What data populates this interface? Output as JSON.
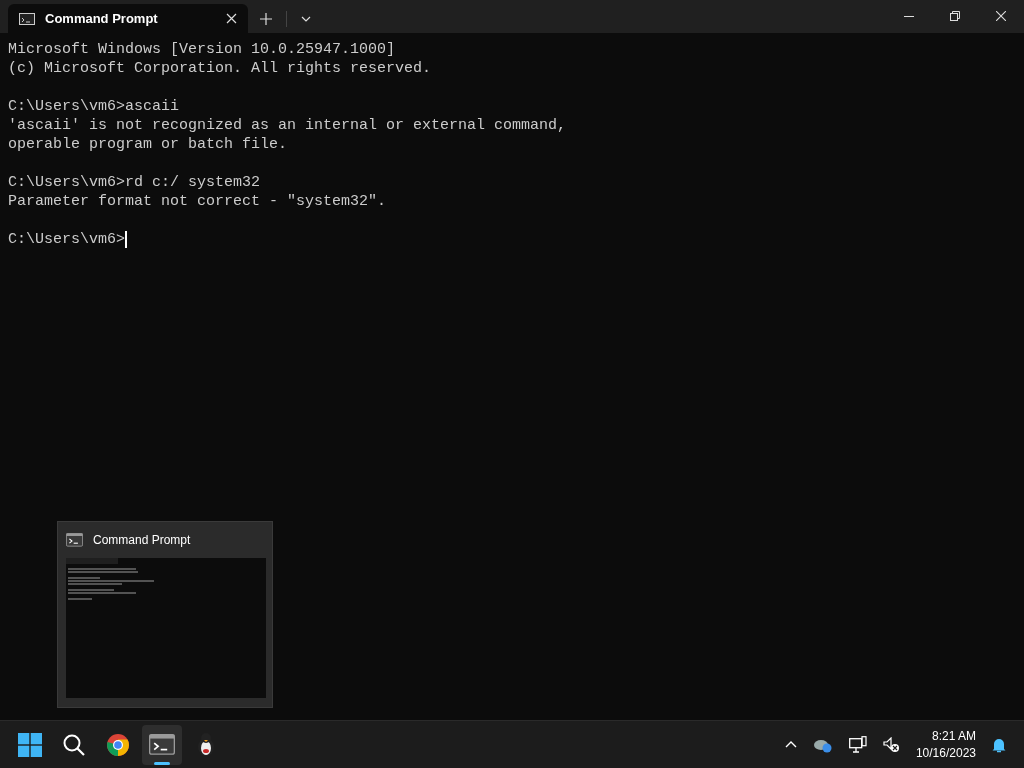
{
  "window": {
    "tabs": [
      {
        "title": "Command Prompt",
        "selected": true
      }
    ]
  },
  "console": {
    "blocks": [
      [
        "Microsoft Windows [Version 10.0.25947.1000]",
        "(c) Microsoft Corporation. All rights reserved."
      ],
      [
        "C:\\Users\\vm6>ascaii",
        "'ascaii' is not recognized as an internal or external command,",
        "operable program or batch file."
      ],
      [
        "C:\\Users\\vm6>rd c:/ system32",
        "Parameter format not correct - \"system32\"."
      ],
      [
        "C:\\Users\\vm6>"
      ]
    ],
    "cursor": true
  },
  "preview": {
    "title": "Command Prompt"
  },
  "taskbar": {
    "apps": [
      {
        "kind": "start",
        "selected": false
      },
      {
        "kind": "search",
        "selected": false
      },
      {
        "kind": "browser",
        "selected": false
      },
      {
        "kind": "terminal",
        "selected": true
      },
      {
        "kind": "penguin",
        "selected": false
      }
    ],
    "clock": {
      "time": "8:21 AM",
      "date": "10/16/2023"
    }
  }
}
